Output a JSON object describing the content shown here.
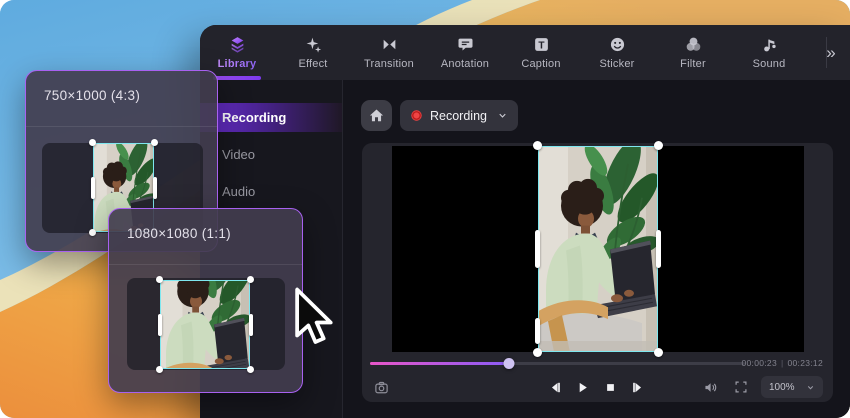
{
  "toolbar": {
    "tabs": [
      {
        "label": "Library",
        "active": true
      },
      {
        "label": "Effect",
        "active": false
      },
      {
        "label": "Transition",
        "active": false
      },
      {
        "label": "Anotation",
        "active": false
      },
      {
        "label": "Caption",
        "active": false
      },
      {
        "label": "Sticker",
        "active": false
      },
      {
        "label": "Filter",
        "active": false
      },
      {
        "label": "Sound",
        "active": false
      }
    ],
    "more_label": "»",
    "caption_glyph": "T"
  },
  "sidebar": {
    "items": [
      {
        "label": "Recording",
        "active": true
      },
      {
        "label": "Video",
        "active": false
      },
      {
        "label": "Audio",
        "active": false
      }
    ]
  },
  "preview": {
    "source_selector": {
      "label": "Recording"
    },
    "player": {
      "current_time": "00:00:23",
      "time_separator": "|",
      "total_time": "00:23:12",
      "progress_percent": 37,
      "zoom_level": "100%"
    }
  },
  "popups": [
    {
      "title": "750×1000 (4:3)"
    },
    {
      "title": "1080×1080 (1:1)"
    }
  ],
  "colors": {
    "accent_purple": "#9333ea",
    "selection_cyan": "#7ee7ef",
    "record_red": "#ef4444",
    "progress_gradient_start": "#e856c8",
    "progress_gradient_end": "#8b5cf6",
    "popup_border": "#a861f0"
  }
}
